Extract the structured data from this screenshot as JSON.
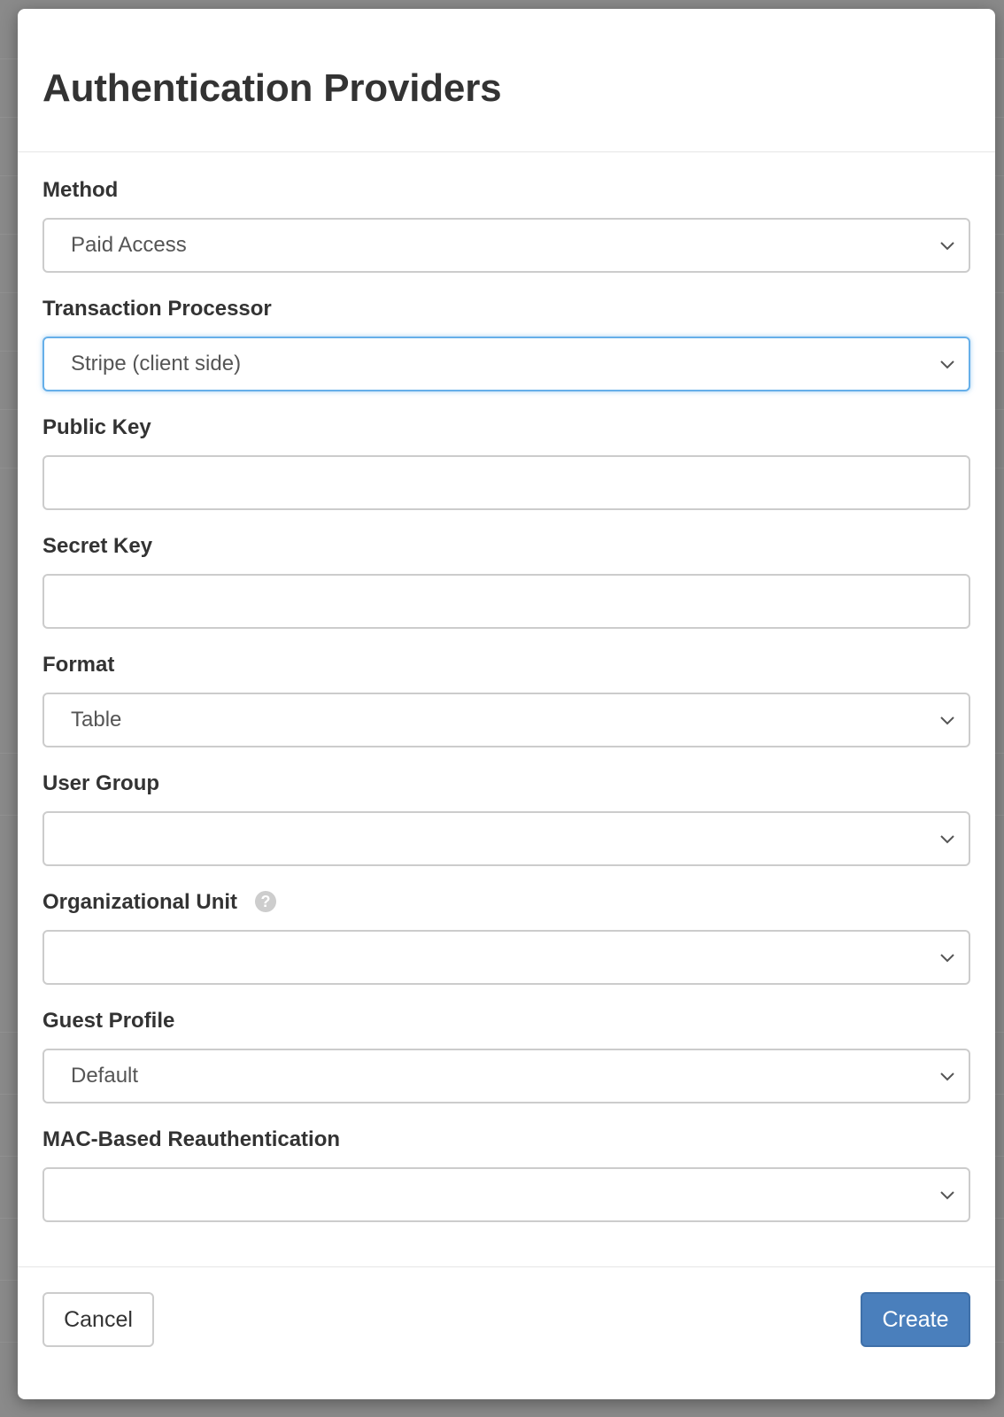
{
  "modal": {
    "title": "Authentication Providers"
  },
  "fields": {
    "method": {
      "label": "Method",
      "value": "Paid Access"
    },
    "transaction_processor": {
      "label": "Transaction Processor",
      "value": "Stripe (client side)"
    },
    "public_key": {
      "label": "Public Key",
      "value": ""
    },
    "secret_key": {
      "label": "Secret Key",
      "value": ""
    },
    "format": {
      "label": "Format",
      "value": "Table"
    },
    "user_group": {
      "label": "User Group",
      "value": ""
    },
    "organizational_unit": {
      "label": "Organizational Unit",
      "value": "",
      "help_icon": "?"
    },
    "guest_profile": {
      "label": "Guest Profile",
      "value": "Default"
    },
    "mac_reauth": {
      "label": "MAC-Based Reauthentication",
      "value": ""
    }
  },
  "footer": {
    "cancel_label": "Cancel",
    "create_label": "Create"
  },
  "colors": {
    "primary": "#4a7fbc",
    "focus": "#66afe9",
    "border": "#cccccc"
  },
  "icons": {
    "select_arrow": "chevron-down-icon",
    "help": "question-circle-icon"
  }
}
